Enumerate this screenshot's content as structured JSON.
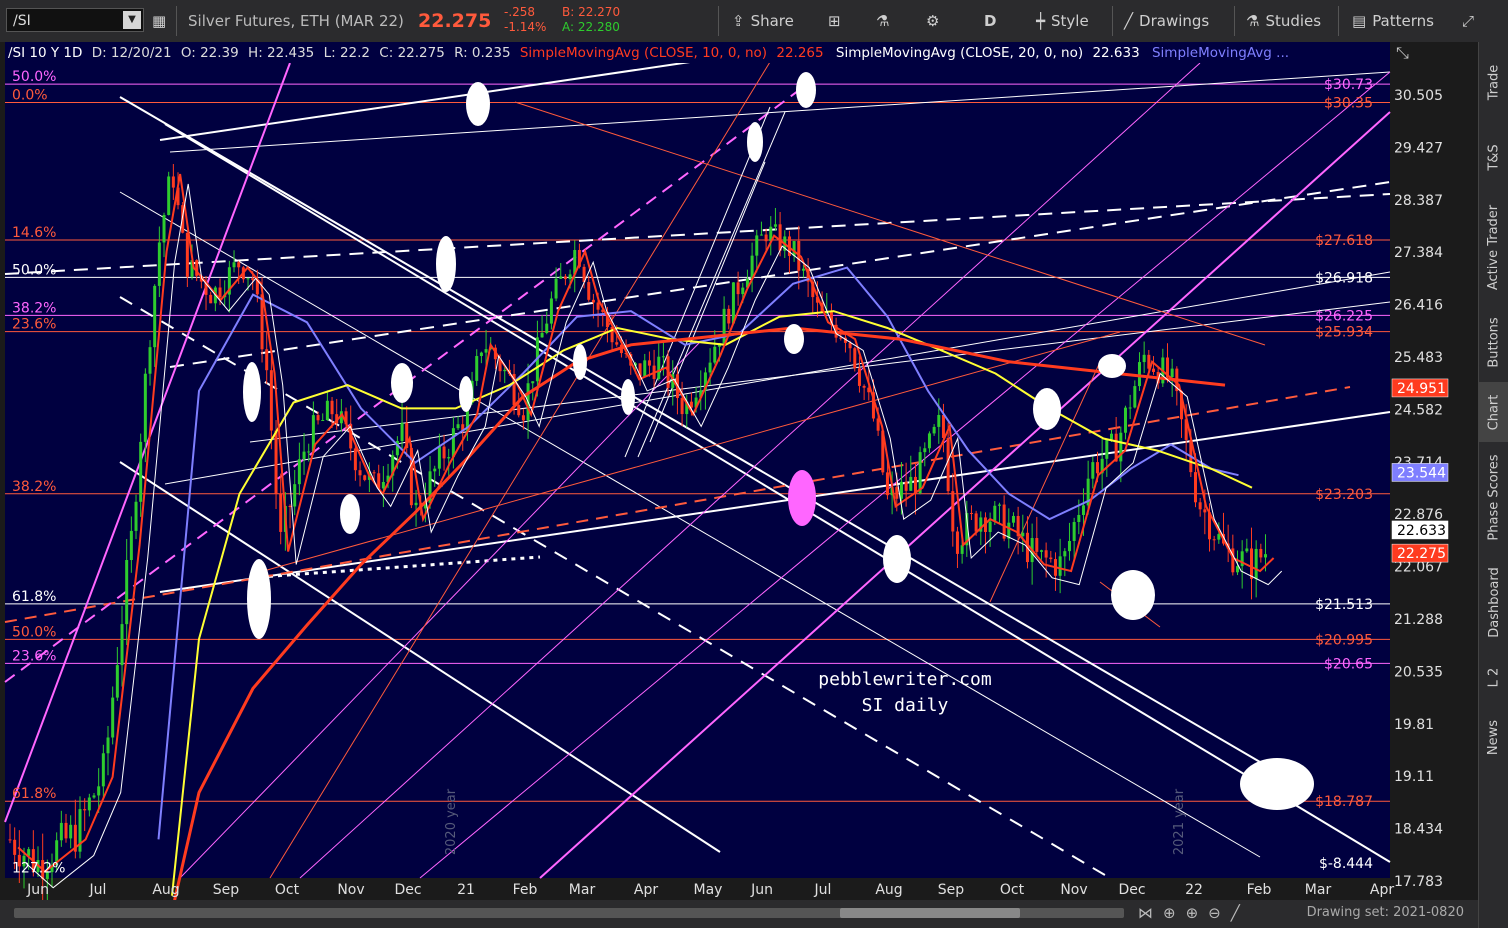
{
  "toolbar": {
    "symbol": "/SI",
    "description": "Silver Futures, ETH (MAR 22)",
    "last": "22.275",
    "change": "-.258",
    "change_pct": "-1.14%",
    "bid": "B: 22.270",
    "ask": "A: 22.280",
    "share": "Share",
    "period": "D",
    "style": "Style",
    "drawings": "Drawings",
    "studies": "Studies",
    "patterns": "Patterns"
  },
  "header": {
    "title": "/SI 10 Y 1D",
    "date": "D: 12/20/21",
    "open": "O: 22.39",
    "high": "H: 22.435",
    "low": "L: 22.2",
    "close": "C: 22.275",
    "range": "R: 0.235",
    "sma10": "SimpleMovingAvg (CLOSE, 10, 0, no)",
    "sma10_val": "22.265",
    "sma20": "SimpleMovingAvg (CLOSE, 20, 0, no)",
    "sma20_val": "22.633",
    "sma50": "SimpleMovingAvg ..."
  },
  "sidebar": [
    "Trade",
    "T&S",
    "Active Trader",
    "Buttons",
    "Chart",
    "Phase Scores",
    "Dashboard",
    "L 2",
    "News"
  ],
  "watermark": [
    "pebblewriter.com",
    "SI daily"
  ],
  "year_labels": [
    "2020 year",
    "2021 year"
  ],
  "drawing_set": "Drawing set: 2021-0820",
  "colors": {
    "bg": "#000040",
    "up": "#2ecc2e",
    "down": "#ff3b1f",
    "sma10": "#ff3b1f",
    "sma20": "#ffffff",
    "sma50": "#7f7fff",
    "sma100": "#ffff33",
    "sma200": "#ff3b1f",
    "fib": "#ff5a3c",
    "magenta": "#ff66ff"
  },
  "chart_data": {
    "type": "candlestick",
    "y_axis_ticks": [
      "30.505",
      "29.427",
      "28.387",
      "27.384",
      "26.416",
      "25.483",
      "24.582",
      "23.714",
      "22.876",
      "22.067",
      "21.288",
      "20.535",
      "19.81",
      "19.11",
      "18.434",
      "17.783"
    ],
    "x_axis_labels": [
      "Jun",
      "Jul",
      "Aug",
      "Sep",
      "Oct",
      "Nov",
      "Dec",
      "21",
      "Feb",
      "Mar",
      "Apr",
      "May",
      "Jun",
      "Jul",
      "Aug",
      "Sep",
      "Oct",
      "Nov",
      "Dec",
      "22",
      "Feb",
      "Mar",
      "Apr"
    ],
    "price_labels": [
      {
        "text": "$30.73",
        "value": 30.73,
        "color": "#ff66ff"
      },
      {
        "text": "$30.35",
        "value": 30.35,
        "color": "#ff5a3c"
      },
      {
        "text": "$27.618",
        "value": 27.618,
        "color": "#ff5a3c"
      },
      {
        "text": "$26.918",
        "value": 26.918,
        "color": "#ffffff"
      },
      {
        "text": "$26.225",
        "value": 26.225,
        "color": "#ff66ff"
      },
      {
        "text": "$25.934",
        "value": 25.934,
        "color": "#ff5a3c"
      },
      {
        "text": "$23.203",
        "value": 23.203,
        "color": "#ff5a3c"
      },
      {
        "text": "$21.513",
        "value": 21.513,
        "color": "#ffffff"
      },
      {
        "text": "$20.995",
        "value": 20.995,
        "color": "#ff5a3c"
      },
      {
        "text": "$20.65",
        "value": 20.65,
        "color": "#ff66ff"
      },
      {
        "text": "$18.787",
        "value": 18.787,
        "color": "#ff5a3c"
      },
      {
        "text": "$-8.444",
        "value": -8.444,
        "color": "#ffffff"
      }
    ],
    "fib_labels": [
      {
        "text": "50.0%",
        "value": 30.73,
        "color": "#ff66ff"
      },
      {
        "text": "0.0%",
        "value": 30.35,
        "color": "#ff5a3c"
      },
      {
        "text": "14.6%",
        "value": 27.618,
        "color": "#ff5a3c"
      },
      {
        "text": "50.0%",
        "value": 26.918,
        "color": "#ffffff"
      },
      {
        "text": "38.2%",
        "value": 26.225,
        "color": "#ff66ff"
      },
      {
        "text": "23.6%",
        "value": 25.934,
        "color": "#ff5a3c"
      },
      {
        "text": "38.2%",
        "value": 23.203,
        "color": "#ff5a3c"
      },
      {
        "text": "61.8%",
        "value": 21.513,
        "color": "#ffffff"
      },
      {
        "text": "50.0%",
        "value": 20.995,
        "color": "#ff5a3c"
      },
      {
        "text": "23.6%",
        "value": 20.65,
        "color": "#ff66ff"
      },
      {
        "text": "61.8%",
        "value": 18.787,
        "color": "#ff5a3c"
      },
      {
        "text": "127.2%",
        "value": 17.85,
        "color": "#ffffff"
      }
    ],
    "badges": [
      {
        "text": "24.951",
        "value": 24.951,
        "bg": "#ff3b1f",
        "fg": "#ffffff"
      },
      {
        "text": "23.544",
        "value": 23.544,
        "bg": "#7f7fff",
        "fg": "#ffffff"
      },
      {
        "text": "22.633",
        "value": 22.633,
        "bg": "#ffffff",
        "fg": "#000000"
      },
      {
        "text": "22.275",
        "value": 22.275,
        "bg": "#ff3b1f",
        "fg": "#ffffff"
      }
    ],
    "close_path": [
      [
        0,
        18.3
      ],
      [
        0.02,
        18.0
      ],
      [
        0.05,
        18.4
      ],
      [
        0.07,
        19.2
      ],
      [
        0.09,
        22.5
      ],
      [
        0.11,
        27.5
      ],
      [
        0.12,
        29.0
      ],
      [
        0.13,
        27.2
      ],
      [
        0.15,
        26.6
      ],
      [
        0.17,
        27.2
      ],
      [
        0.18,
        26.9
      ],
      [
        0.19,
        25.3
      ],
      [
        0.2,
        22.4
      ],
      [
        0.22,
        24.1
      ],
      [
        0.24,
        24.6
      ],
      [
        0.26,
        23.6
      ],
      [
        0.27,
        23.3
      ],
      [
        0.29,
        24.2
      ],
      [
        0.3,
        22.9
      ],
      [
        0.32,
        23.8
      ],
      [
        0.34,
        24.6
      ],
      [
        0.35,
        25.8
      ],
      [
        0.37,
        25.1
      ],
      [
        0.38,
        24.6
      ],
      [
        0.4,
        26.4
      ],
      [
        0.42,
        27.5
      ],
      [
        0.43,
        26.6
      ],
      [
        0.45,
        25.7
      ],
      [
        0.46,
        25.2
      ],
      [
        0.48,
        25.4
      ],
      [
        0.5,
        24.6
      ],
      [
        0.52,
        25.6
      ],
      [
        0.54,
        26.8
      ],
      [
        0.56,
        27.8
      ],
      [
        0.58,
        27.4
      ],
      [
        0.6,
        26.2
      ],
      [
        0.62,
        25.9
      ],
      [
        0.64,
        24.4
      ],
      [
        0.65,
        23.1
      ],
      [
        0.67,
        23.4
      ],
      [
        0.69,
        24.4
      ],
      [
        0.7,
        22.5
      ],
      [
        0.72,
        22.9
      ],
      [
        0.74,
        22.7
      ],
      [
        0.76,
        22.2
      ],
      [
        0.78,
        22.1
      ],
      [
        0.8,
        23.6
      ],
      [
        0.82,
        24.0
      ],
      [
        0.84,
        25.5
      ],
      [
        0.86,
        25.1
      ],
      [
        0.88,
        23.1
      ],
      [
        0.9,
        22.3
      ],
      [
        0.92,
        22.1
      ],
      [
        0.93,
        22.3
      ]
    ],
    "sma_series": [
      {
        "name": "SMA 50",
        "color": "#7f7fff",
        "points": [
          [
            0.11,
            18.3
          ],
          [
            0.14,
            24.9
          ],
          [
            0.18,
            26.6
          ],
          [
            0.22,
            26.1
          ],
          [
            0.26,
            24.6
          ],
          [
            0.3,
            23.7
          ],
          [
            0.34,
            24.3
          ],
          [
            0.38,
            25.2
          ],
          [
            0.42,
            26.2
          ],
          [
            0.46,
            26.3
          ],
          [
            0.5,
            25.7
          ],
          [
            0.54,
            25.9
          ],
          [
            0.58,
            26.8
          ],
          [
            0.62,
            27.1
          ],
          [
            0.65,
            26.2
          ],
          [
            0.68,
            24.9
          ],
          [
            0.71,
            23.9
          ],
          [
            0.74,
            23.2
          ],
          [
            0.77,
            22.8
          ],
          [
            0.8,
            23.1
          ],
          [
            0.83,
            23.6
          ],
          [
            0.86,
            24.0
          ],
          [
            0.89,
            23.6
          ],
          [
            0.91,
            23.5
          ]
        ]
      },
      {
        "name": "SMA 100",
        "color": "#ffff33",
        "points": [
          [
            0.12,
            17.6
          ],
          [
            0.14,
            21.0
          ],
          [
            0.17,
            23.2
          ],
          [
            0.21,
            24.7
          ],
          [
            0.25,
            25.0
          ],
          [
            0.29,
            24.6
          ],
          [
            0.33,
            24.6
          ],
          [
            0.37,
            25.0
          ],
          [
            0.41,
            25.6
          ],
          [
            0.45,
            26.0
          ],
          [
            0.49,
            25.8
          ],
          [
            0.53,
            25.7
          ],
          [
            0.57,
            26.2
          ],
          [
            0.61,
            26.3
          ],
          [
            0.65,
            26.0
          ],
          [
            0.69,
            25.6
          ],
          [
            0.73,
            25.2
          ],
          [
            0.77,
            24.6
          ],
          [
            0.81,
            24.1
          ],
          [
            0.85,
            23.9
          ],
          [
            0.89,
            23.6
          ],
          [
            0.92,
            23.3
          ]
        ]
      },
      {
        "name": "SMA 200",
        "color": "#ff3b1f",
        "points": [
          [
            0.12,
            17.4
          ],
          [
            0.14,
            18.9
          ],
          [
            0.18,
            20.3
          ],
          [
            0.22,
            21.2
          ],
          [
            0.26,
            22.1
          ],
          [
            0.3,
            22.9
          ],
          [
            0.34,
            23.8
          ],
          [
            0.38,
            24.8
          ],
          [
            0.42,
            25.4
          ],
          [
            0.46,
            25.7
          ],
          [
            0.5,
            25.8
          ],
          [
            0.54,
            25.9
          ],
          [
            0.58,
            26.0
          ],
          [
            0.62,
            25.9
          ],
          [
            0.66,
            25.8
          ],
          [
            0.7,
            25.6
          ],
          [
            0.74,
            25.4
          ],
          [
            0.78,
            25.3
          ],
          [
            0.82,
            25.2
          ],
          [
            0.86,
            25.1
          ],
          [
            0.9,
            25.0
          ]
        ]
      }
    ]
  }
}
